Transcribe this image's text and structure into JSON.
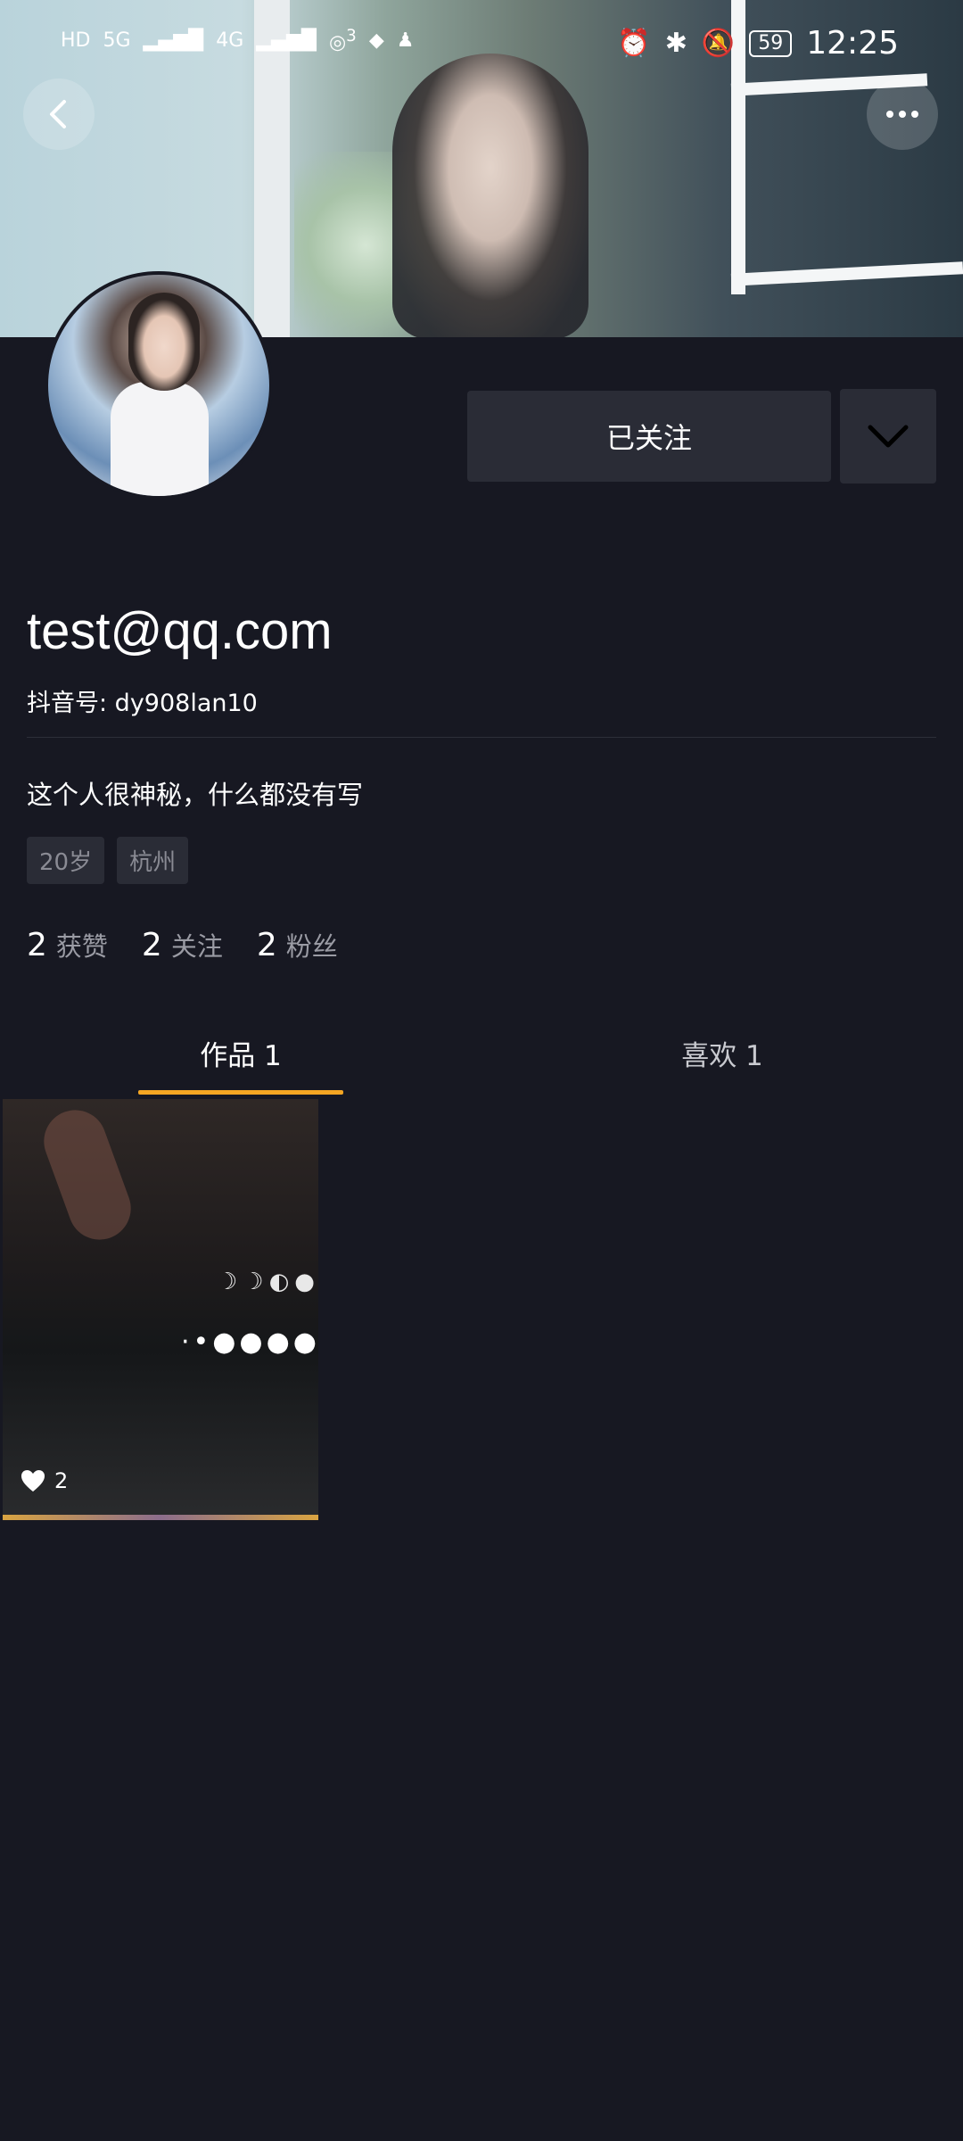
{
  "status_bar": {
    "network": [
      "HD",
      "5G",
      "4G"
    ],
    "wifi_badge": "3",
    "battery": "59",
    "time": "12:25"
  },
  "profile": {
    "username": "test@qq.com",
    "douyin_id": "抖音号: dy908lan10",
    "bio": "这个人很神秘，什么都没有写",
    "tags": [
      "20岁",
      "杭州"
    ],
    "follow_button": "已关注"
  },
  "stats": [
    {
      "num": "2",
      "label": "获赞"
    },
    {
      "num": "2",
      "label": "关注"
    },
    {
      "num": "2",
      "label": "粉丝"
    }
  ],
  "tabs": [
    {
      "label": "作品 1"
    },
    {
      "label": "喜欢 1"
    }
  ],
  "videos": [
    {
      "likes": "2"
    }
  ],
  "colors": {
    "background": "#171822",
    "button_bg": "#2a2c36",
    "accent": "#f5a623"
  }
}
